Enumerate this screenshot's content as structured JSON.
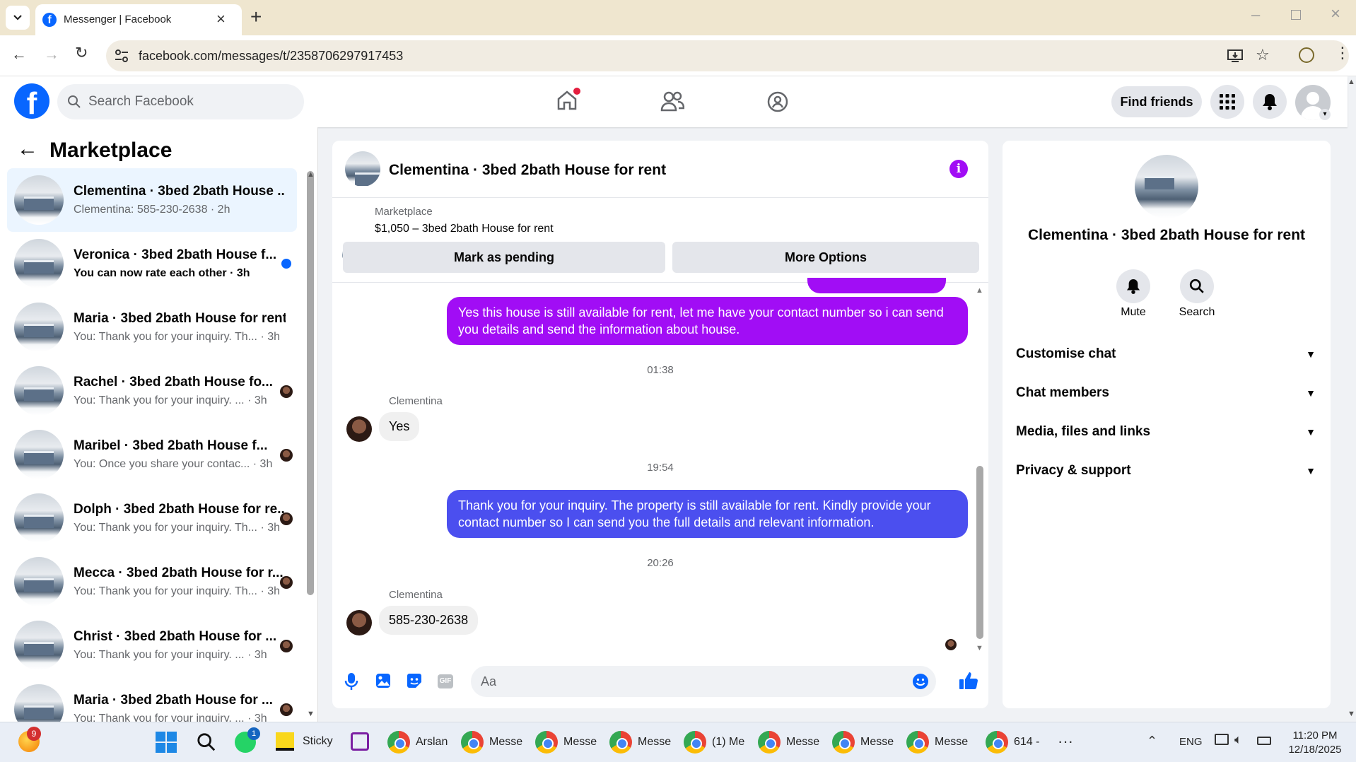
{
  "browser": {
    "tab_title": "Messenger | Facebook",
    "url": "facebook.com/messages/t/2358706297917453"
  },
  "fb_header": {
    "search_placeholder": "Search Facebook",
    "find_friends": "Find friends"
  },
  "sidebar": {
    "title": "Marketplace",
    "conversations": [
      {
        "name": "Clementina · 3bed 2bath House ...",
        "snippet": "Clementina: 585-230-2638 · 2h",
        "unread": false,
        "active": true
      },
      {
        "name": "Veronica · 3bed 2bath House f...",
        "snippet": "You can now rate each other · 3h",
        "unread": true
      },
      {
        "name": "Maria · 3bed 2bath House for rent",
        "snippet": "You: Thank you for your inquiry. Th... · 3h"
      },
      {
        "name": "Rachel · 3bed 2bath House fo...",
        "snippet": "You: Thank you for your inquiry. ... · 3h"
      },
      {
        "name": "Maribel · 3bed 2bath House f...",
        "snippet": "You: Once you share your contac... · 3h"
      },
      {
        "name": "Dolph · 3bed 2bath House for re...",
        "snippet": "You: Thank you for your inquiry. Th... · 3h"
      },
      {
        "name": "Mecca · 3bed 2bath House for r...",
        "snippet": "You: Thank you for your inquiry. Th... · 3h"
      },
      {
        "name": "Christ · 3bed 2bath House for ...",
        "snippet": "You: Thank you for your inquiry. ... · 3h"
      },
      {
        "name": "Maria · 3bed 2bath House for ...",
        "snippet": "You: Thank you for your inquiry. ... · 3h"
      }
    ]
  },
  "chat": {
    "title": "Clementina · 3bed 2bath House for rent",
    "listing_source": "Marketplace",
    "listing_price": "$1,050 – 3bed 2bath House for rent",
    "mark_pending": "Mark as pending",
    "more_options": "More Options",
    "messages": [
      {
        "type": "out",
        "text": "Yes this house is still available for rent, let me have your contact number so i can send you details and send the information about house."
      },
      {
        "type": "time",
        "text": "01:38"
      },
      {
        "type": "sender",
        "text": "Clementina"
      },
      {
        "type": "in",
        "text": "Yes"
      },
      {
        "type": "time",
        "text": "19:54"
      },
      {
        "type": "out",
        "text": "Thank you for your inquiry. The property is still available for rent. Kindly provide your contact number so I can send you the full details and relevant information."
      },
      {
        "type": "time",
        "text": "20:26"
      },
      {
        "type": "sender",
        "text": "Clementina"
      },
      {
        "type": "in",
        "text": "585-230-2638"
      }
    ],
    "composer_placeholder": "Aa"
  },
  "info_panel": {
    "title": "Clementina · 3bed 2bath House for rent",
    "mute": "Mute",
    "search": "Search",
    "sections": [
      "Customise chat",
      "Chat members",
      "Media, files and links",
      "Privacy & support"
    ]
  },
  "taskbar": {
    "badge_main": "9",
    "whatsapp_badge": "1",
    "apps": [
      "Sticky",
      "Arslan",
      "Messe",
      "Messe",
      "Messe",
      "(1) Me",
      "Messe",
      "Messe",
      "Messe",
      "614 -"
    ],
    "lang": "ENG",
    "time": "11:20 PM",
    "date": "12/18/2025"
  },
  "colors": {
    "fb_blue": "#0866ff",
    "outgoing_purple": "#a10df5",
    "outgoing_blue": "#4b4fef",
    "accent_purple": "#a10df5"
  }
}
